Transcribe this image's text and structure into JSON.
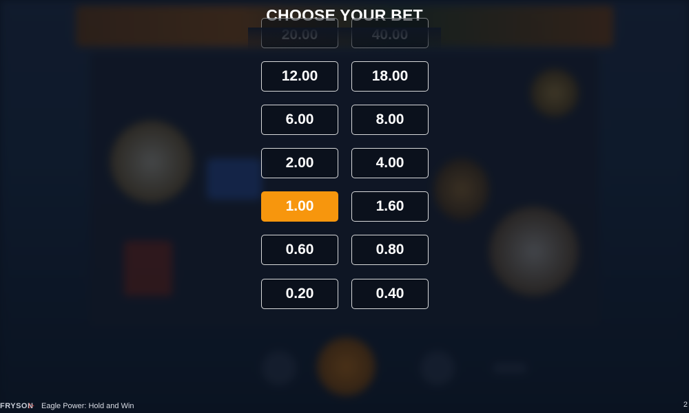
{
  "dialog": {
    "title": "CHOOSE YOUR BET"
  },
  "bets": {
    "partial": [
      "20.00",
      "40.00"
    ],
    "rows": [
      [
        "12.00",
        "18.00"
      ],
      [
        "6.00",
        "8.00"
      ],
      [
        "2.00",
        "4.00"
      ],
      [
        "1.00",
        "1.60"
      ],
      [
        "0.60",
        "0.80"
      ],
      [
        "0.20",
        "0.40"
      ]
    ],
    "selected": "1.00",
    "selected_color": "#f7960d"
  },
  "footer": {
    "brand": "FRYSON",
    "game_name": "Eagle Power: Hold and Win",
    "corner_text": "2"
  }
}
